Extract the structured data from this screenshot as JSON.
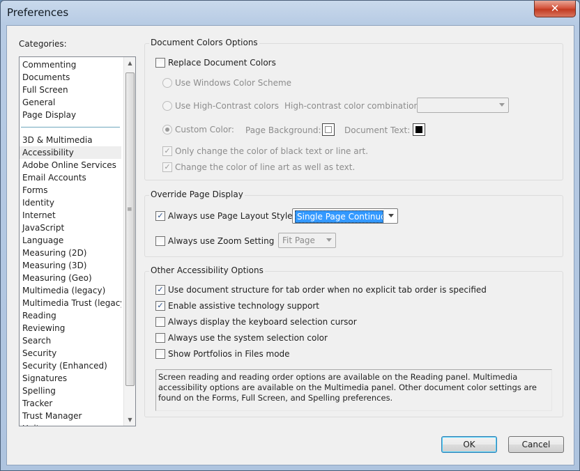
{
  "window": {
    "title": "Preferences",
    "close_glyph": "✕"
  },
  "categories": {
    "label": "Categories:",
    "top_items": [
      "Commenting",
      "Documents",
      "Full Screen",
      "General",
      "Page Display"
    ],
    "items": [
      "3D & Multimedia",
      "Accessibility",
      "Adobe Online Services",
      "Email Accounts",
      "Forms",
      "Identity",
      "Internet",
      "JavaScript",
      "Language",
      "Measuring (2D)",
      "Measuring (3D)",
      "Measuring (Geo)",
      "Multimedia (legacy)",
      "Multimedia Trust (legacy)",
      "Reading",
      "Reviewing",
      "Search",
      "Security",
      "Security (Enhanced)",
      "Signatures",
      "Spelling",
      "Tracker",
      "Trust Manager",
      "Units"
    ],
    "selected": "Accessibility"
  },
  "doc_colors": {
    "title": "Document Colors Options",
    "replace_label": "Replace Document Colors",
    "windows_scheme_label": "Use Windows Color Scheme",
    "high_contrast_label": "Use High-Contrast colors",
    "hc_combination_label": "High-contrast color combination:",
    "custom_color_label": "Custom Color:",
    "page_background_label": "Page Background:",
    "document_text_label": "Document Text:",
    "only_black_label": "Only change the color of black text or line art.",
    "line_art_label": "Change the color of line art as well as text."
  },
  "override": {
    "title": "Override Page Display",
    "page_layout_label": "Always use Page Layout Style",
    "page_layout_value": "Single Page Continuous",
    "zoom_label": "Always use Zoom Setting",
    "zoom_value": "Fit Page"
  },
  "other": {
    "title": "Other Accessibility Options",
    "structure_label": "Use document structure for tab order when no explicit tab order is specified",
    "assistive_label": "Enable assistive technology support",
    "keyboard_cursor_label": "Always display the keyboard selection cursor",
    "system_color_label": "Always use the system selection color",
    "portfolios_label": "Show Portfolios in Files mode",
    "note": "Screen reading and reading order options are available on the Reading panel. Multimedia accessibility options are available on the Multimedia panel. Other document color settings are found on the Forms, Full Screen, and Spelling preferences."
  },
  "buttons": {
    "ok": "OK",
    "cancel": "Cancel"
  },
  "check_glyph": "✓"
}
